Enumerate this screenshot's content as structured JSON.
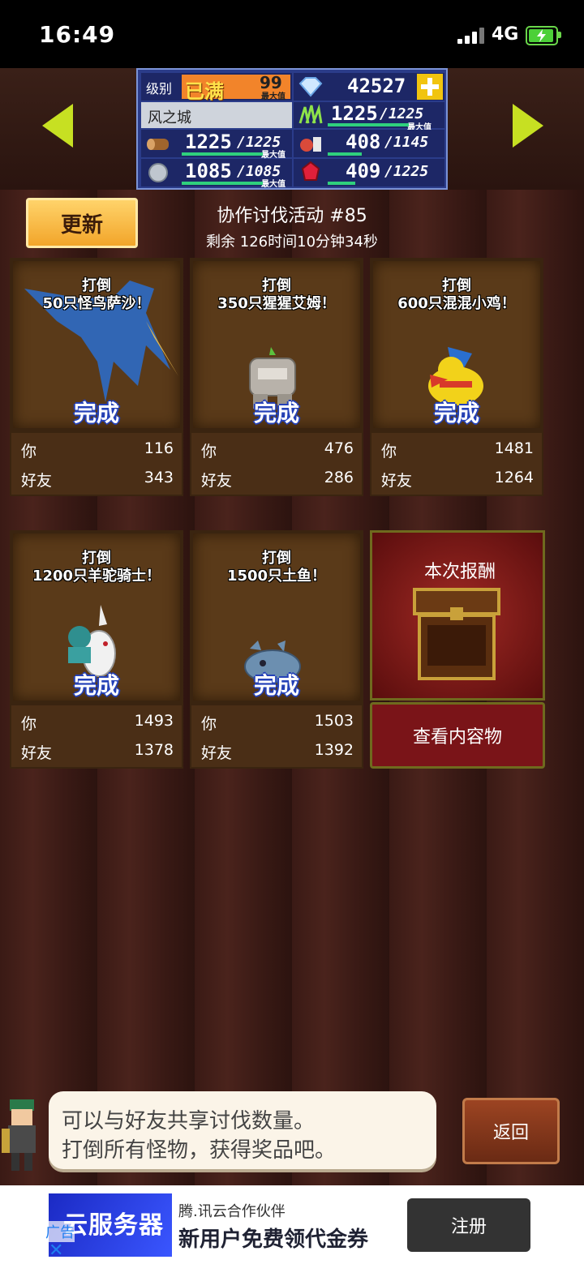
{
  "status_bar": {
    "time": "16:49",
    "network": "4G"
  },
  "panel": {
    "level_label": "级别",
    "level_status": "已满",
    "level_max_value": "99",
    "max_tag": "最大值",
    "gems": "42527",
    "city_name": "风之城",
    "wood": "1225",
    "wood_max": "/1225",
    "grass": "1225",
    "grass_max": "/1225",
    "food": "408",
    "food_max": "/1145",
    "ore": "1085",
    "ore_max": "/1085",
    "ruby": "409",
    "ruby_max": "/1225",
    "colors": {
      "panel_bg": "#2b3c8a",
      "bar": "#2fd07d",
      "level_orange": "#f2842a"
    }
  },
  "header": {
    "refresh_button": "更新",
    "event_title": "协作讨伐活动 #85",
    "remaining": "剩余 126时间10分钟34秒"
  },
  "cards": [
    {
      "line1": "打倒",
      "line2": "50只怪鸟萨沙！",
      "status": "完成",
      "you_label": "你",
      "you": "116",
      "friend_label": "好友",
      "friend": "343",
      "monster_icon": "blue-bird-monster-icon"
    },
    {
      "line1": "打倒",
      "line2": "350只猩猩艾姆！",
      "status": "完成",
      "you_label": "你",
      "you": "476",
      "friend_label": "好友",
      "friend": "286",
      "monster_icon": "stone-ape-monster-icon"
    },
    {
      "line1": "打倒",
      "line2": "600只混混小鸡！",
      "status": "完成",
      "you_label": "你",
      "you": "1481",
      "friend_label": "好友",
      "friend": "1264",
      "monster_icon": "yellow-chick-monster-icon"
    },
    {
      "line1": "打倒",
      "line2": "1200只羊驼骑士！",
      "status": "完成",
      "you_label": "你",
      "you": "1493",
      "friend_label": "好友",
      "friend": "1378",
      "monster_icon": "alpaca-knight-monster-icon"
    },
    {
      "line1": "打倒",
      "line2": "1500只土鱼！",
      "status": "完成",
      "you_label": "你",
      "you": "1503",
      "friend_label": "好友",
      "friend": "1392",
      "monster_icon": "mud-fish-monster-icon"
    }
  ],
  "reward": {
    "title": "本次报酬",
    "button": "查看内容物"
  },
  "bottom": {
    "message_line1": "可以与好友共享讨伐数量。",
    "message_line2": "打倒所有怪物，获得奖品吧。",
    "back_button": "返回"
  },
  "ad": {
    "image_text": "云服务器",
    "label": "广告",
    "close": "✕",
    "sponsor": "腾.讯云合作伙伴",
    "headline": "新用户免费领代金券",
    "register_button": "注册"
  }
}
